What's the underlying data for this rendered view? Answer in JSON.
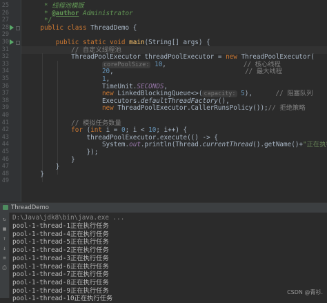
{
  "editor": {
    "lines": [
      {
        "n": "25",
        "c": [
          {
            "t": "     * ",
            "s": "doc"
          },
          {
            "t": "线程池模版",
            "s": "doc"
          }
        ]
      },
      {
        "n": "26",
        "c": [
          {
            "t": "     * ",
            "s": "doc"
          },
          {
            "t": "@author",
            "s": "tag"
          },
          {
            "t": " Administrator",
            "s": "doc"
          }
        ]
      },
      {
        "n": "27",
        "c": [
          {
            "t": "     */",
            "s": "doc"
          }
        ]
      },
      {
        "n": "28",
        "run": true,
        "c": [
          {
            "t": "    ",
            "s": ""
          },
          {
            "t": "public class ",
            "s": "kw"
          },
          {
            "t": "ThreadDemo {",
            "s": ""
          }
        ]
      },
      {
        "n": "29",
        "c": []
      },
      {
        "n": "30",
        "run": true,
        "c": [
          {
            "t": "        ",
            "s": ""
          },
          {
            "t": "public static void ",
            "s": "kw"
          },
          {
            "t": "main",
            "s": "fn"
          },
          {
            "t": "(String[] args) {",
            "s": ""
          }
        ]
      },
      {
        "n": "31",
        "c": [
          {
            "t": "            ",
            "s": ""
          },
          {
            "t": "// 自定义线程池",
            "s": "cm"
          }
        ]
      },
      {
        "n": "32",
        "c": [
          {
            "t": "            ThreadPoolExecutor threadPoolExecutor = ",
            "s": ""
          },
          {
            "t": "new ",
            "s": "kw"
          },
          {
            "t": "ThreadPoolExecutor(",
            "s": ""
          }
        ]
      },
      {
        "n": "33",
        "c": [
          {
            "t": "                    ",
            "s": ""
          },
          {
            "t": "corePoolSize:",
            "s": "hint"
          },
          {
            "t": " ",
            "s": ""
          },
          {
            "t": "10",
            "s": "num"
          },
          {
            "t": ",                    ",
            "s": ""
          },
          {
            "t": "// 核心线程",
            "s": "cm"
          }
        ]
      },
      {
        "n": "34",
        "c": [
          {
            "t": "                    ",
            "s": ""
          },
          {
            "t": "20",
            "s": "num"
          },
          {
            "t": ",                                  ",
            "s": ""
          },
          {
            "t": "// 最大线程",
            "s": "cm"
          }
        ]
      },
      {
        "n": "35",
        "c": [
          {
            "t": "                    ",
            "s": ""
          },
          {
            "t": "1",
            "s": "num"
          },
          {
            "t": ",",
            "s": ""
          }
        ]
      },
      {
        "n": "36",
        "c": [
          {
            "t": "                    TimeUnit.",
            "s": ""
          },
          {
            "t": "SECONDS",
            "s": "field"
          },
          {
            "t": ",",
            "s": ""
          }
        ]
      },
      {
        "n": "37",
        "c": [
          {
            "t": "                    ",
            "s": ""
          },
          {
            "t": "new ",
            "s": "kw"
          },
          {
            "t": "LinkedBlockingQueue<>(",
            "s": ""
          },
          {
            "t": "capacity:",
            "s": "hint"
          },
          {
            "t": " ",
            "s": ""
          },
          {
            "t": "5",
            "s": "num"
          },
          {
            "t": "),      ",
            "s": ""
          },
          {
            "t": "// 阻塞队列",
            "s": "cm"
          }
        ]
      },
      {
        "n": "38",
        "c": [
          {
            "t": "                    Executors.",
            "s": ""
          },
          {
            "t": "defaultThreadFactory",
            "s": "it"
          },
          {
            "t": "(),",
            "s": ""
          }
        ]
      },
      {
        "n": "39",
        "c": [
          {
            "t": "                    ",
            "s": ""
          },
          {
            "t": "new ",
            "s": "kw"
          },
          {
            "t": "ThreadPoolExecutor.CallerRunsPolicy());",
            "s": ""
          },
          {
            "t": "// 拒绝策略",
            "s": "cm"
          }
        ]
      },
      {
        "n": "40",
        "c": []
      },
      {
        "n": "41",
        "c": [
          {
            "t": "            ",
            "s": ""
          },
          {
            "t": "// 模拟任务数量",
            "s": "cm"
          }
        ]
      },
      {
        "n": "42",
        "c": [
          {
            "t": "            ",
            "s": ""
          },
          {
            "t": "for ",
            "s": "kw"
          },
          {
            "t": "(",
            "s": ""
          },
          {
            "t": "int ",
            "s": "kw"
          },
          {
            "t": "i = ",
            "s": ""
          },
          {
            "t": "0",
            "s": "num"
          },
          {
            "t": "; i < ",
            "s": ""
          },
          {
            "t": "10",
            "s": "num"
          },
          {
            "t": "; i++) {",
            "s": ""
          }
        ]
      },
      {
        "n": "43",
        "c": [
          {
            "t": "                threadPoolExecutor.execute(() -> {",
            "s": ""
          }
        ]
      },
      {
        "n": "44",
        "c": [
          {
            "t": "                    System.",
            "s": ""
          },
          {
            "t": "out",
            "s": "field"
          },
          {
            "t": ".println(Thread.",
            "s": ""
          },
          {
            "t": "currentThread",
            "s": "it"
          },
          {
            "t": "().getName()+",
            "s": ""
          },
          {
            "t": "\"正在执行任务\"",
            "s": "str"
          },
          {
            "t": ");",
            "s": ""
          }
        ]
      },
      {
        "n": "45",
        "c": [
          {
            "t": "                });",
            "s": ""
          }
        ]
      },
      {
        "n": "46",
        "c": [
          {
            "t": "            }",
            "s": ""
          }
        ]
      },
      {
        "n": "47",
        "c": [
          {
            "t": "        }",
            "s": ""
          }
        ]
      },
      {
        "n": "48",
        "c": [
          {
            "t": "    }",
            "s": ""
          }
        ]
      },
      {
        "n": "49",
        "c": []
      }
    ]
  },
  "run_tab": {
    "label": "ThreadDemo"
  },
  "console": {
    "command": "D:\\Java\\jdk8\\bin\\java.exe ...",
    "output": [
      "pool-1-thread-1正在执行任务",
      "pool-1-thread-4正在执行任务",
      "pool-1-thread-5正在执行任务",
      "pool-1-thread-2正在执行任务",
      "pool-1-thread-3正在执行任务",
      "pool-1-thread-6正在执行任务",
      "pool-1-thread-7正在执行任务",
      "pool-1-thread-8正在执行任务",
      "pool-1-thread-9正在执行任务",
      "pool-1-thread-10正在执行任务"
    ]
  },
  "watermark": "CSDN @青衫."
}
